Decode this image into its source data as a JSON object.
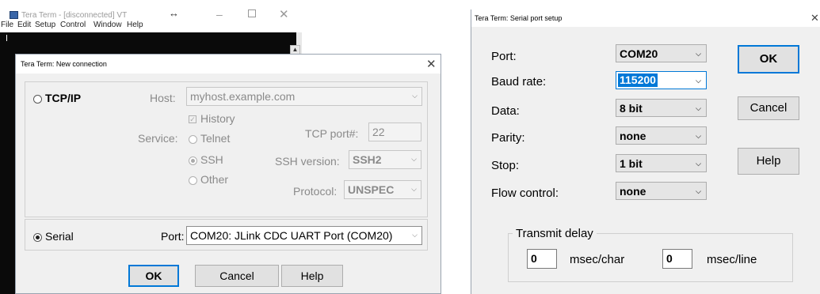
{
  "main_window": {
    "title": "Tera Term - [disconnected] VT",
    "menu": [
      "File",
      "Edit",
      "Setup",
      "Control",
      "Window",
      "Help"
    ]
  },
  "new_connection": {
    "title": "Tera Term: New connection",
    "tcpip_label": "TCP/IP",
    "host_label": "Host:",
    "host_value": "myhost.example.com",
    "history_label": "History",
    "service_label": "Service:",
    "telnet_label": "Telnet",
    "tcp_port_label": "TCP port#:",
    "tcp_port_value": "22",
    "ssh_label": "SSH",
    "ssh_version_label": "SSH version:",
    "ssh_version_value": "SSH2",
    "other_label": "Other",
    "protocol_label": "Protocol:",
    "protocol_value": "UNSPEC",
    "serial_label": "Serial",
    "port_label": "Port:",
    "port_value": "COM20: JLink CDC UART Port (COM20)",
    "ok_label": "OK",
    "cancel_label": "Cancel",
    "help_label": "Help"
  },
  "serial_setup": {
    "title": "Tera Term: Serial port setup",
    "port_label": "Port:",
    "port_value": "COM20",
    "baud_label": "Baud rate:",
    "baud_value": "115200",
    "data_label": "Data:",
    "data_value": "8 bit",
    "parity_label": "Parity:",
    "parity_value": "none",
    "stop_label": "Stop:",
    "stop_value": "1 bit",
    "flow_label": "Flow control:",
    "flow_value": "none",
    "transmit_delay_label": "Transmit delay",
    "char_delay_value": "0",
    "char_unit": "msec/char",
    "line_delay_value": "0",
    "line_unit": "msec/line",
    "ok_label": "OK",
    "cancel_label": "Cancel",
    "help_label": "Help"
  },
  "colors": {
    "accent": "#0078d7",
    "dialog_bg": "#f0f0f0",
    "terminal_bg": "#0a0a0a"
  }
}
